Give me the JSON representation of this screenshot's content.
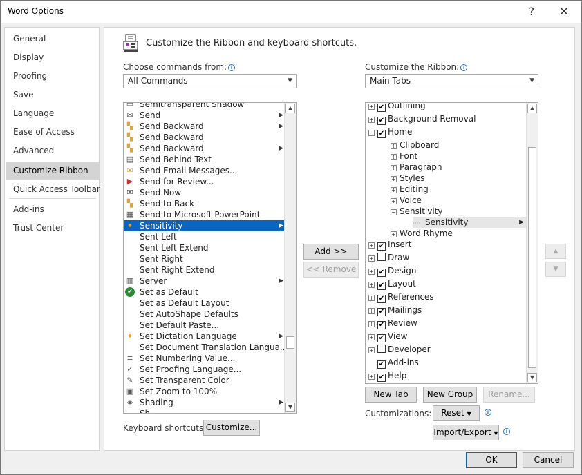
{
  "window": {
    "title": "Word Options",
    "help_icon": "?",
    "close_icon": "✕"
  },
  "nav": {
    "items": [
      "General",
      "Display",
      "Proofing",
      "Save",
      "Language",
      "Ease of Access",
      "Advanced",
      "Customize Ribbon",
      "Quick Access Toolbar",
      "Add-ins",
      "Trust Center"
    ],
    "selected": "Customize Ribbon"
  },
  "main": {
    "heading": "Customize the Ribbon and keyboard shortcuts.",
    "choose_label": "Choose commands from:",
    "choose_value": "All Commands",
    "customize_label": "Customize the Ribbon:",
    "customize_value": "Main Tabs",
    "keyboard_label": "Keyboard shortcuts:",
    "customize_btn": "Customize...",
    "customizations_label": "Customizations:"
  },
  "commands": [
    {
      "label": "Semitransparent Shadow",
      "icon": "shadow-icon",
      "glyph": "▭",
      "submenu": false
    },
    {
      "label": "Send",
      "icon": "send-icon",
      "glyph": "✉",
      "submenu": true
    },
    {
      "label": "Send Backward",
      "icon": "send-backward-icon",
      "glyph": "▚",
      "submenu": true
    },
    {
      "label": "Send Backward",
      "icon": "send-backward-icon",
      "glyph": "▚",
      "submenu": false
    },
    {
      "label": "Send Backward",
      "icon": "send-backward-icon",
      "glyph": "▚",
      "submenu": true
    },
    {
      "label": "Send Behind Text",
      "icon": "send-behind-text-icon",
      "glyph": "▤",
      "submenu": false
    },
    {
      "label": "Send Email Messages...",
      "icon": "email-icon",
      "glyph": "✉",
      "submenu": false
    },
    {
      "label": "Send for Review...",
      "icon": "review-icon",
      "glyph": "▶",
      "submenu": false
    },
    {
      "label": "Send Now",
      "icon": "send-now-icon",
      "glyph": "✉",
      "submenu": false
    },
    {
      "label": "Send to Back",
      "icon": "send-to-back-icon",
      "glyph": "▚",
      "submenu": false
    },
    {
      "label": "Send to Microsoft PowerPoint",
      "icon": "powerpoint-icon",
      "glyph": "▦",
      "submenu": false
    },
    {
      "label": "Sensitivity",
      "icon": "sensitivity-icon",
      "glyph": "●",
      "submenu": true
    },
    {
      "label": "Sent Left",
      "icon": "",
      "glyph": "",
      "submenu": false
    },
    {
      "label": "Sent Left Extend",
      "icon": "",
      "glyph": "",
      "submenu": false
    },
    {
      "label": "Sent Right",
      "icon": "",
      "glyph": "",
      "submenu": false
    },
    {
      "label": "Sent Right Extend",
      "icon": "",
      "glyph": "",
      "submenu": false
    },
    {
      "label": "Server",
      "icon": "server-icon",
      "glyph": "▥",
      "submenu": true
    },
    {
      "label": "Set as Default",
      "icon": "check-circle-icon",
      "glyph": "✔",
      "submenu": false
    },
    {
      "label": "Set as Default Layout",
      "icon": "",
      "glyph": "",
      "submenu": false
    },
    {
      "label": "Set AutoShape Defaults",
      "icon": "",
      "glyph": "",
      "submenu": false
    },
    {
      "label": "Set Default Paste...",
      "icon": "",
      "glyph": "",
      "submenu": false
    },
    {
      "label": "Set Dictation Language",
      "icon": "dictation-icon",
      "glyph": "●",
      "submenu": true
    },
    {
      "label": "Set Document Translation Langua...",
      "icon": "",
      "glyph": "",
      "submenu": false
    },
    {
      "label": "Set Numbering Value...",
      "icon": "numbering-icon",
      "glyph": "≡",
      "submenu": false
    },
    {
      "label": "Set Proofing Language...",
      "icon": "proofing-icon",
      "glyph": "✓",
      "submenu": false
    },
    {
      "label": "Set Transparent Color",
      "icon": "transparent-color-icon",
      "glyph": "✎",
      "submenu": false
    },
    {
      "label": "Set Zoom to 100%",
      "icon": "zoom-icon",
      "glyph": "▣",
      "submenu": false
    },
    {
      "label": "Shading",
      "icon": "shading-icon",
      "glyph": "◈",
      "submenu": true
    },
    {
      "label": "Sh...",
      "icon": "",
      "glyph": "",
      "submenu": false
    }
  ],
  "tree": [
    {
      "label": "Outlining",
      "level": 0,
      "exp": "+",
      "check": true
    },
    {
      "label": "Background Removal",
      "level": 0,
      "exp": "+",
      "check": true
    },
    {
      "label": "Home",
      "level": 0,
      "exp": "−",
      "check": true
    },
    {
      "label": "Clipboard",
      "level": 1,
      "exp": "+",
      "check": null
    },
    {
      "label": "Font",
      "level": 1,
      "exp": "+",
      "check": null
    },
    {
      "label": "Paragraph",
      "level": 1,
      "exp": "+",
      "check": null
    },
    {
      "label": "Styles",
      "level": 1,
      "exp": "+",
      "check": null
    },
    {
      "label": "Editing",
      "level": 1,
      "exp": "+",
      "check": null
    },
    {
      "label": "Voice",
      "level": 1,
      "exp": "+",
      "check": null
    },
    {
      "label": "Sensitivity",
      "level": 1,
      "exp": "−",
      "check": null
    },
    {
      "label": "Sensitivity",
      "level": 2,
      "exp": "",
      "check": null
    },
    {
      "label": "Word Rhyme",
      "level": 1,
      "exp": "+",
      "check": null
    },
    {
      "label": "Insert",
      "level": 0,
      "exp": "+",
      "check": true
    },
    {
      "label": "Draw",
      "level": 0,
      "exp": "+",
      "check": false
    },
    {
      "label": "Design",
      "level": 0,
      "exp": "+",
      "check": true
    },
    {
      "label": "Layout",
      "level": 0,
      "exp": "+",
      "check": true
    },
    {
      "label": "References",
      "level": 0,
      "exp": "+",
      "check": true
    },
    {
      "label": "Mailings",
      "level": 0,
      "exp": "+",
      "check": true
    },
    {
      "label": "Review",
      "level": 0,
      "exp": "+",
      "check": true
    },
    {
      "label": "View",
      "level": 0,
      "exp": "+",
      "check": true
    },
    {
      "label": "Developer",
      "level": 0,
      "exp": "+",
      "check": false
    },
    {
      "label": "Add-ins",
      "level": 0,
      "exp": "",
      "check": true
    },
    {
      "label": "Help",
      "level": 0,
      "exp": "+",
      "check": true
    }
  ],
  "buttons": {
    "add": "Add >>",
    "remove": "<< Remove",
    "new_tab": "New Tab",
    "new_group": "New Group",
    "rename": "Rename...",
    "reset": "Reset",
    "import_export": "Import/Export",
    "ok": "OK",
    "cancel": "Cancel"
  },
  "colors": {
    "selection": "#0a64c2",
    "nav_selected": "#d4d4d4",
    "info": "#2b6fc6"
  }
}
